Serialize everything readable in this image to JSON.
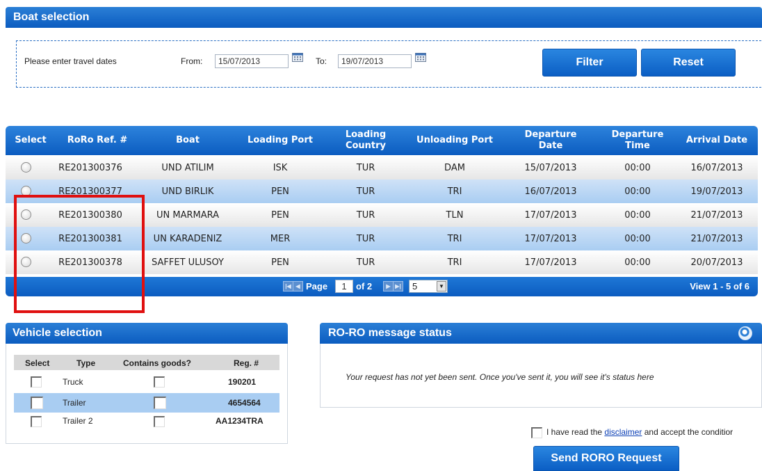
{
  "boat_selection": {
    "title": "Boat selection",
    "date_prompt": "Please enter travel dates",
    "from_label": "From:",
    "from_value": "15/07/2013",
    "to_label": "To:",
    "to_value": "19/07/2013",
    "filter_label": "Filter",
    "reset_label": "Reset",
    "columns": [
      "Select",
      "RoRo Ref. #",
      "Boat",
      "Loading Port",
      "Loading Country",
      "Unloading Port",
      "Departure Date",
      "Departure Time",
      "Arrival Date"
    ],
    "columns_split": {
      "loading_country": [
        "Loading",
        "Country"
      ],
      "departure_date": [
        "Departure",
        "Date"
      ],
      "departure_time": [
        "Departure",
        "Time"
      ]
    },
    "rows": [
      {
        "ref": "RE201300376",
        "boat": "UND ATILIM",
        "loading_port": "ISK",
        "loading_country": "TUR",
        "unloading_port": "DAM",
        "departure_date": "15/07/2013",
        "departure_time": "00:00",
        "arrival_date": "16/07/2013"
      },
      {
        "ref": "RE201300377",
        "boat": "UND BIRLIK",
        "loading_port": "PEN",
        "loading_country": "TUR",
        "unloading_port": "TRI",
        "departure_date": "16/07/2013",
        "departure_time": "00:00",
        "arrival_date": "19/07/2013"
      },
      {
        "ref": "RE201300380",
        "boat": "UN MARMARA",
        "loading_port": "PEN",
        "loading_country": "TUR",
        "unloading_port": "TLN",
        "departure_date": "17/07/2013",
        "departure_time": "00:00",
        "arrival_date": "21/07/2013"
      },
      {
        "ref": "RE201300381",
        "boat": "UN KARADENIZ",
        "loading_port": "MER",
        "loading_country": "TUR",
        "unloading_port": "TRI",
        "departure_date": "17/07/2013",
        "departure_time": "00:00",
        "arrival_date": "21/07/2013"
      },
      {
        "ref": "RE201300378",
        "boat": "SAFFET ULUSOY",
        "loading_port": "PEN",
        "loading_country": "TUR",
        "unloading_port": "TRI",
        "departure_date": "17/07/2013",
        "departure_time": "00:00",
        "arrival_date": "20/07/2013"
      }
    ],
    "pager": {
      "page_label": "Page",
      "page_value": "1",
      "of_label": "of 2",
      "rows_value": "5",
      "view_label": "View 1 - 5 of 6"
    }
  },
  "vehicle_selection": {
    "title": "Vehicle selection",
    "columns": [
      "Select",
      "Type",
      "Contains goods?",
      "Reg. #"
    ],
    "rows": [
      {
        "type": "Truck",
        "reg": "190201"
      },
      {
        "type": "Trailer",
        "reg": "4654564"
      },
      {
        "type": "Trailer 2",
        "reg": "AA1234TRA"
      }
    ]
  },
  "roro_status": {
    "title": "RO-RO message status",
    "message": "Your request has not yet been sent. Once you've sent it, you will see it's status here"
  },
  "disclaimer": {
    "prefix": "I have read the ",
    "link": "disclaimer",
    "suffix": " and accept the conditior"
  },
  "send_label": "Send RORO Request",
  "colors": {
    "header_blue": "#0b5cc0",
    "row_blue": "#bcd8f5",
    "highlight_red": "#e01010"
  }
}
